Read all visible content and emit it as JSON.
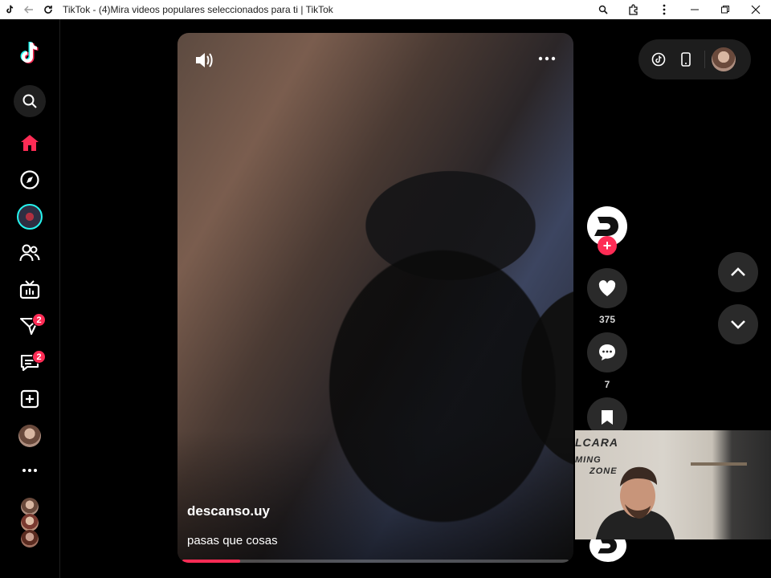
{
  "window": {
    "title": "TikTok - (4)Mira videos populares seleccionados para ti | TikTok"
  },
  "sidebar": {
    "items": [
      {
        "name": "search",
        "label": "Buscar"
      },
      {
        "name": "home",
        "label": "Para ti"
      },
      {
        "name": "explore",
        "label": "Explorar"
      },
      {
        "name": "live-avatar",
        "label": ""
      },
      {
        "name": "following",
        "label": "Siguiendo"
      },
      {
        "name": "live",
        "label": "LIVE"
      },
      {
        "name": "activity",
        "label": "Actividad",
        "badge": "2"
      },
      {
        "name": "messages",
        "label": "Mensajes",
        "badge": "2"
      },
      {
        "name": "upload",
        "label": "Subir"
      },
      {
        "name": "profile",
        "label": "Perfil"
      },
      {
        "name": "more",
        "label": "Más"
      }
    ]
  },
  "video": {
    "author": "descanso.uy",
    "caption": "pasas que cosas",
    "progress": 0.15
  },
  "actions": {
    "likes": "375",
    "comments": "7",
    "follow_glyph": "+"
  },
  "colors": {
    "accent": "#fe2c55",
    "button_bg": "#2a2a2a",
    "background": "#000000"
  }
}
